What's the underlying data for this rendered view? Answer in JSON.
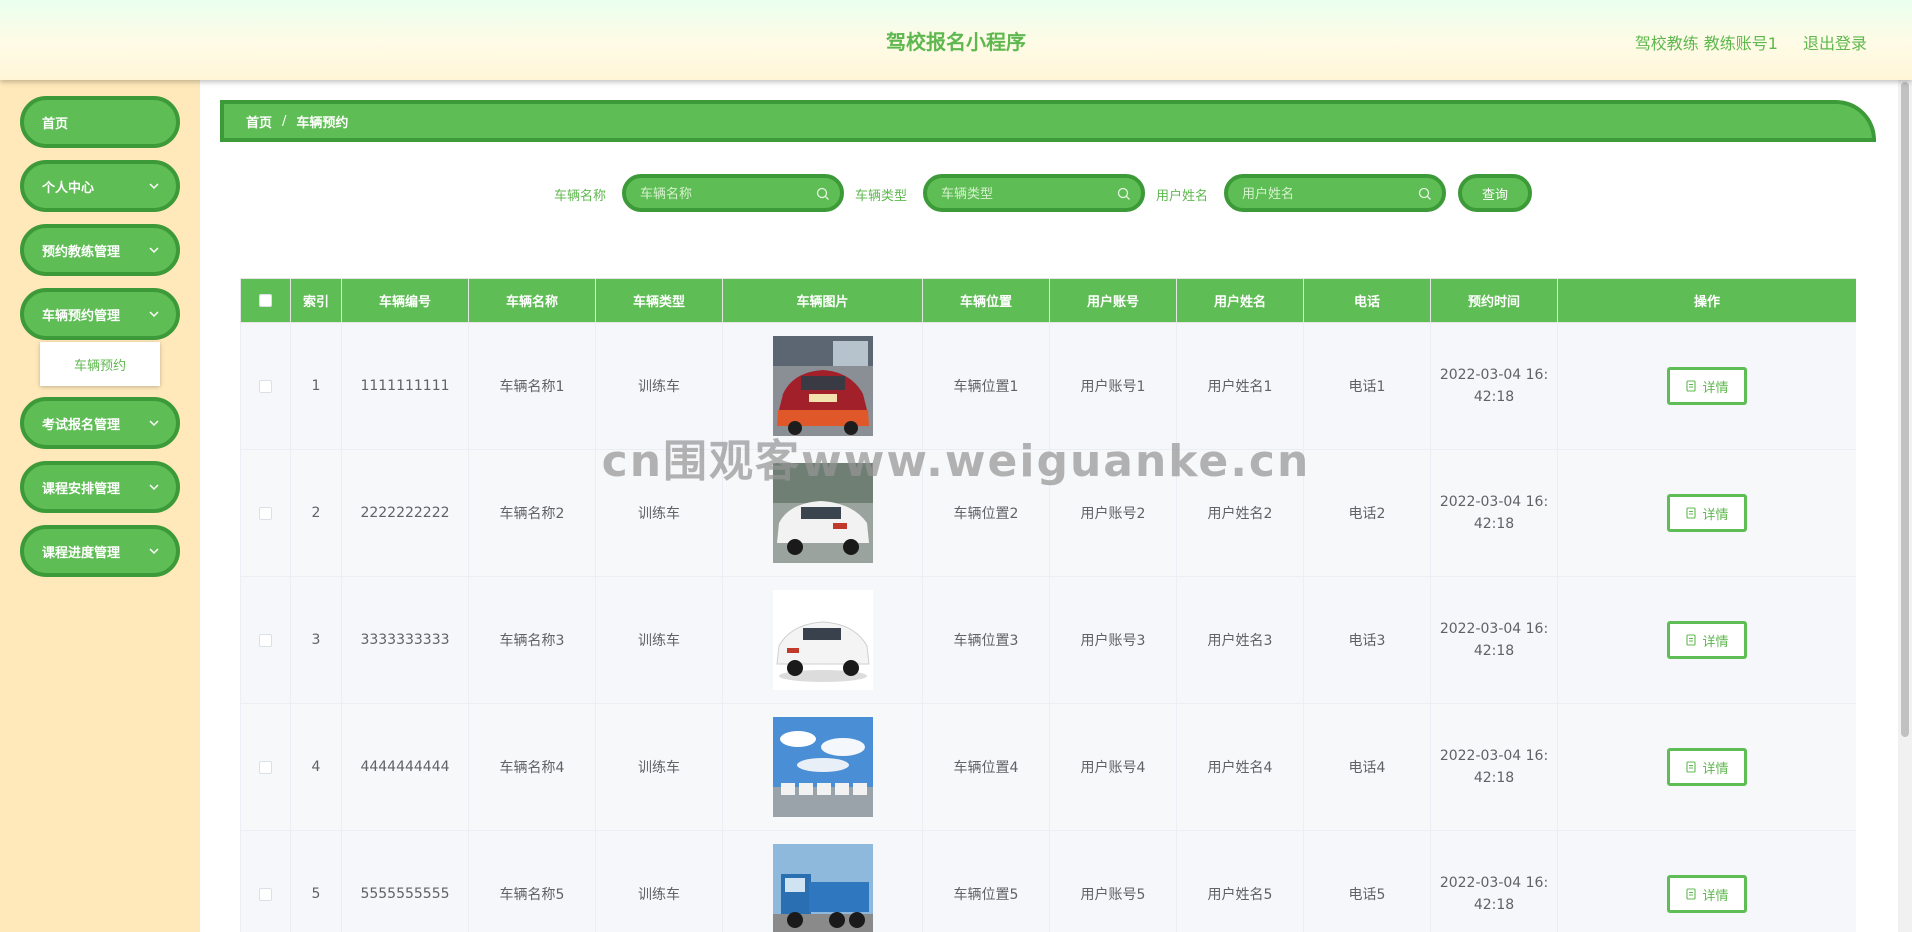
{
  "header": {
    "title": "驾校报名小程序",
    "user": "驾校教练 教练账号1",
    "logout": "退出登录"
  },
  "sidebar": {
    "items": [
      {
        "label": "首页"
      },
      {
        "label": "个人中心"
      },
      {
        "label": "预约教练管理"
      },
      {
        "label": "车辆预约管理",
        "sub": "车辆预约"
      },
      {
        "label": "考试报名管理"
      },
      {
        "label": "课程安排管理"
      },
      {
        "label": "课程进度管理"
      }
    ]
  },
  "breadcrumb": {
    "home": "首页",
    "sep": "/",
    "current": "车辆预约"
  },
  "search": {
    "vehicle_name_label": "车辆名称",
    "vehicle_name_placeholder": "车辆名称",
    "vehicle_type_label": "车辆类型",
    "vehicle_type_placeholder": "车辆类型",
    "user_name_label": "用户姓名",
    "user_name_placeholder": "用户姓名",
    "query": "查询"
  },
  "table": {
    "headers": [
      "索引",
      "车辆编号",
      "车辆名称",
      "车辆类型",
      "车辆图片",
      "车辆位置",
      "用户账号",
      "用户姓名",
      "电话",
      "预约时间",
      "操作"
    ],
    "detail_label": "详情",
    "rows": [
      {
        "index": "1",
        "number": "1111111111",
        "name": "车辆名称1",
        "type": "训练车",
        "location": "车辆位置1",
        "account": "用户账号1",
        "username": "用户姓名1",
        "phone": "电话1",
        "time_a": "2022-03-04 16:",
        "time_b": "42:18"
      },
      {
        "index": "2",
        "number": "2222222222",
        "name": "车辆名称2",
        "type": "训练车",
        "location": "车辆位置2",
        "account": "用户账号2",
        "username": "用户姓名2",
        "phone": "电话2",
        "time_a": "2022-03-04 16:",
        "time_b": "42:18"
      },
      {
        "index": "3",
        "number": "3333333333",
        "name": "车辆名称3",
        "type": "训练车",
        "location": "车辆位置3",
        "account": "用户账号3",
        "username": "用户姓名3",
        "phone": "电话3",
        "time_a": "2022-03-04 16:",
        "time_b": "42:18"
      },
      {
        "index": "4",
        "number": "4444444444",
        "name": "车辆名称4",
        "type": "训练车",
        "location": "车辆位置4",
        "account": "用户账号4",
        "username": "用户姓名4",
        "phone": "电话4",
        "time_a": "2022-03-04 16:",
        "time_b": "42:18"
      },
      {
        "index": "5",
        "number": "5555555555",
        "name": "车辆名称5",
        "type": "训练车",
        "location": "车辆位置5",
        "account": "用户账号5",
        "username": "用户姓名5",
        "phone": "电话5",
        "time_a": "2022-03-04 16:",
        "time_b": "42:18"
      }
    ]
  },
  "watermark": "cn围观客www.weiguanke.cn",
  "colors": {
    "primary": "#5fbd55",
    "primary_dark": "#3d9a38",
    "text_green": "#5fb84f",
    "sidebar_bg": "#ffe9bb"
  }
}
